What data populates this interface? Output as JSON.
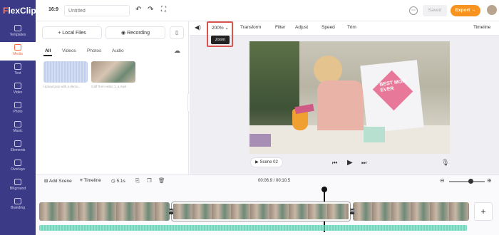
{
  "app": {
    "logo": "FlexClip"
  },
  "sidebar": {
    "items": [
      {
        "label": "Templates"
      },
      {
        "label": "Media"
      },
      {
        "label": "Text"
      },
      {
        "label": "Video"
      },
      {
        "label": "Photo"
      },
      {
        "label": "Music"
      },
      {
        "label": "Elements"
      },
      {
        "label": "Overlays"
      },
      {
        "label": "BKground"
      },
      {
        "label": "Branding"
      }
    ]
  },
  "topbar": {
    "ratio": "16:9",
    "title_placeholder": "Untitled",
    "saved": "Saved",
    "export": "Export →"
  },
  "left": {
    "local_files": "Local Files",
    "recording": "Recording",
    "tabs": [
      "All",
      "Videos",
      "Photos",
      "Audio"
    ],
    "media": [
      {
        "caption": "Upload pop with a demo..."
      },
      {
        "caption": "Gaff from video 1_a.mp4"
      }
    ]
  },
  "toolbar": {
    "zoom": "200%",
    "zoom_tooltip": "Zoom",
    "transform": "Transform",
    "filter": "Filter",
    "adjust": "Adjust",
    "speed": "Speed",
    "trim": "Trim",
    "timeline": "Timeline"
  },
  "preview": {
    "shirt_text": "BEST MOM EVER",
    "scene": "Scene 02"
  },
  "timeline": {
    "add_scene": "Add Scene",
    "timeline": "Timeline",
    "duration": "5.1s",
    "time": "00:06.9 / 00:10.5"
  },
  "colors": {
    "sidebar": "#3b3a86",
    "accent": "#ff6a3d",
    "export": "#f7931e",
    "zoom_highlight": "#d9534f",
    "audio": "#3cc7a6"
  }
}
